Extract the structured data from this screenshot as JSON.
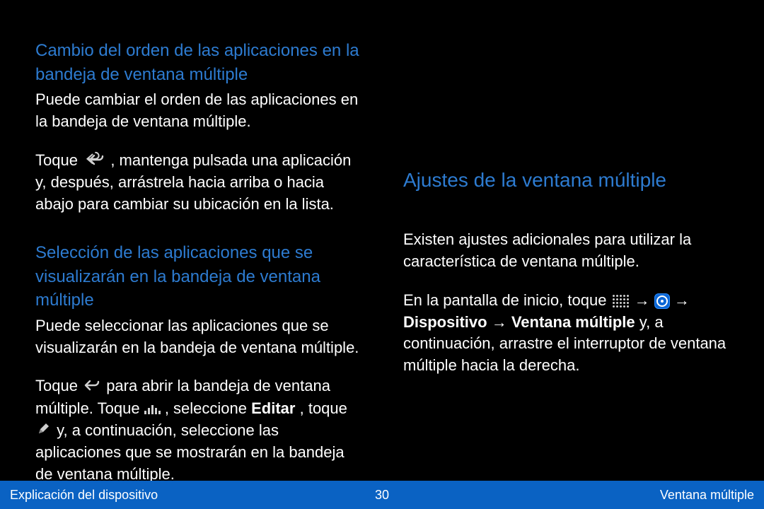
{
  "left": {
    "heading1": "Cambio del orden de las aplicaciones en la bandeja de ventana múltiple",
    "para1a": "Puede cambiar el orden de las aplicaciones en la bandeja de ventana múltiple.",
    "para1b": "Toque ",
    "para1c": ", mantenga pulsada una aplicación y, después, arrástrela hacia arriba o hacia abajo para cambiar su ubicación en la lista.",
    "heading2": "Selección de las aplicaciones que se visualizarán en la bandeja de ventana múltiple",
    "para2a": "Puede seleccionar las aplicaciones que se visualizarán en la bandeja de ventana múltiple.",
    "para2b": "Toque ",
    "para2c": " para abrir la bandeja de ventana múltiple. Toque ",
    "para2d": ", seleccione ",
    "para2e": "Editar",
    "para2f": ", toque ",
    "para2g": " y, a continuación, seleccione las aplicaciones que se mostrarán en la bandeja de ventana múltiple."
  },
  "right": {
    "heading": "Ajustes de la ventana múltiple",
    "para1": "Existen ajustes adicionales para utilizar la característica de ventana múltiple.",
    "para2a": "En la pantalla de inicio, toque ",
    "para2b": " → ",
    "para2c": " → ",
    "para2d": "Dispositivo",
    "para2e": " → ",
    "para2f": "Ventana múltiple",
    "para2g": " y, a continuación, arrastre el interruptor de ventana múltiple hacia la derecha."
  },
  "footer": {
    "left": "Explicación del dispositivo",
    "center": "30",
    "right": "Ventana múltiple"
  }
}
